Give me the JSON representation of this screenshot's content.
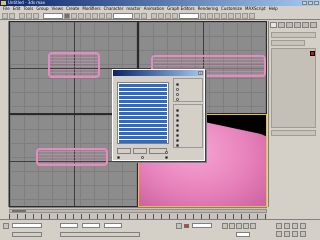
{
  "window": {
    "title": "Untitled - 3ds max"
  },
  "menus": [
    "File",
    "Edit",
    "Tools",
    "Group",
    "Views",
    "Create",
    "Modifiers",
    "Character",
    "reactor",
    "Animation",
    "Graph Editors",
    "Rendering",
    "Customize",
    "MAXScript",
    "Help"
  ],
  "toolbar": {
    "selection_set": ""
  },
  "viewports": [
    {
      "id": "top",
      "label": ""
    },
    {
      "id": "front",
      "label": ""
    },
    {
      "id": "left",
      "label": ""
    },
    {
      "id": "perspective",
      "label": ""
    }
  ],
  "dialog": {
    "title": "",
    "list_items": [
      "",
      "",
      "",
      "",
      "",
      "",
      "",
      "",
      "",
      "",
      "",
      "",
      "",
      "",
      "",
      "",
      "",
      "",
      ""
    ],
    "options_group1": [
      "",
      "",
      "",
      ""
    ],
    "options_group2": [
      "",
      "",
      "",
      "",
      "",
      "",
      "",
      ""
    ],
    "buttons": [
      "",
      "",
      ""
    ],
    "checks": [
      "",
      "",
      "",
      ""
    ]
  },
  "timeline": {
    "frame_label": ""
  },
  "colors": {
    "object": "#e680bb",
    "active_viewport_border": "#e8c030",
    "swatch": "#d01010",
    "title_bar": "#0a246a"
  }
}
